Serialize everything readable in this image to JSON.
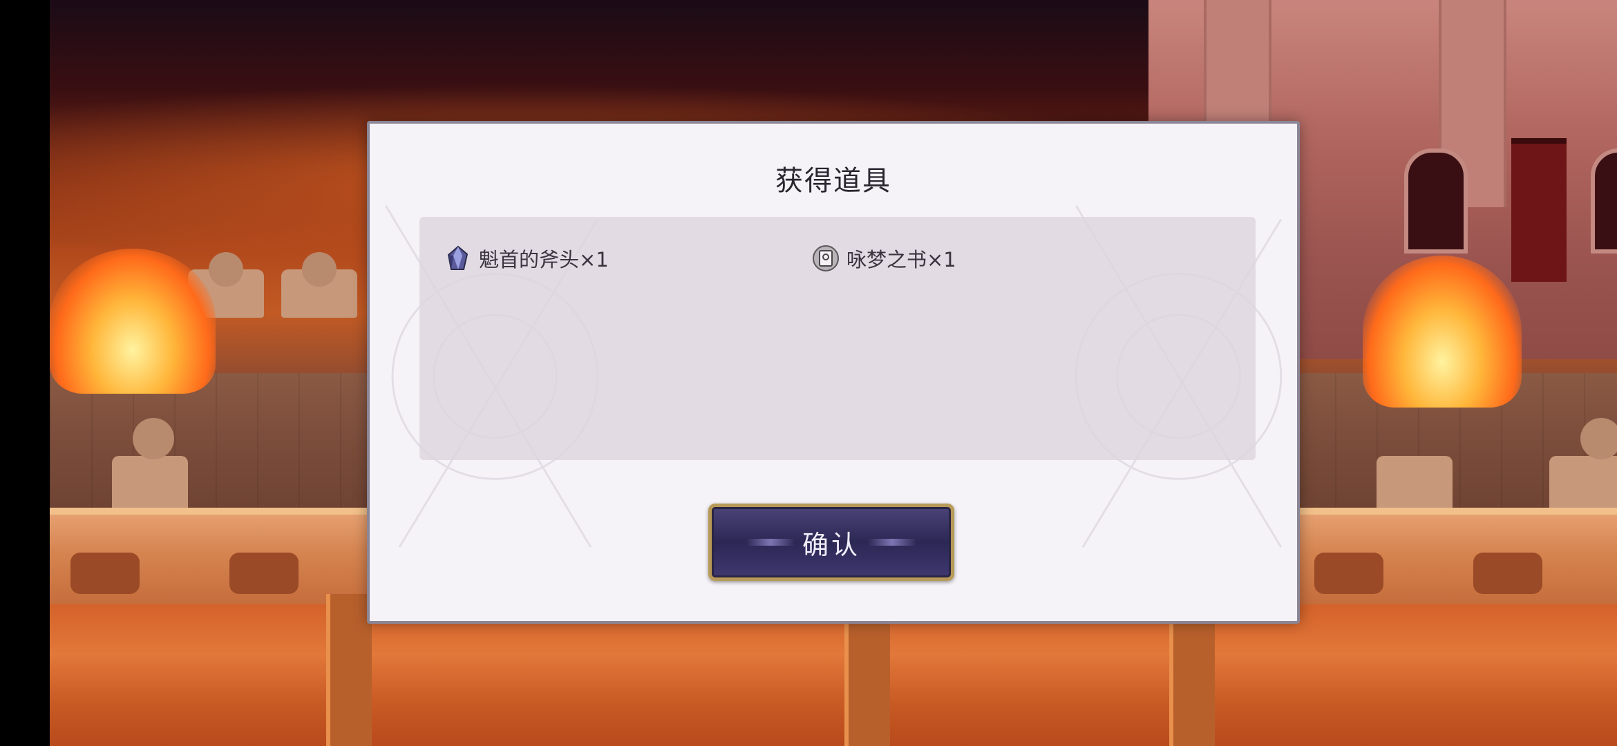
{
  "dialog": {
    "title": "获得道具",
    "items": [
      {
        "icon": "crystal-icon",
        "label": "魁首的斧头×1"
      },
      {
        "icon": "book-icon",
        "label": "咏梦之书×1"
      }
    ],
    "confirm_label": "确认"
  },
  "colors": {
    "dialog_bg": "#f6f3f8",
    "panel_bg": "#ded6de",
    "button_bg": "#2c2854",
    "button_border": "#b89a58"
  }
}
